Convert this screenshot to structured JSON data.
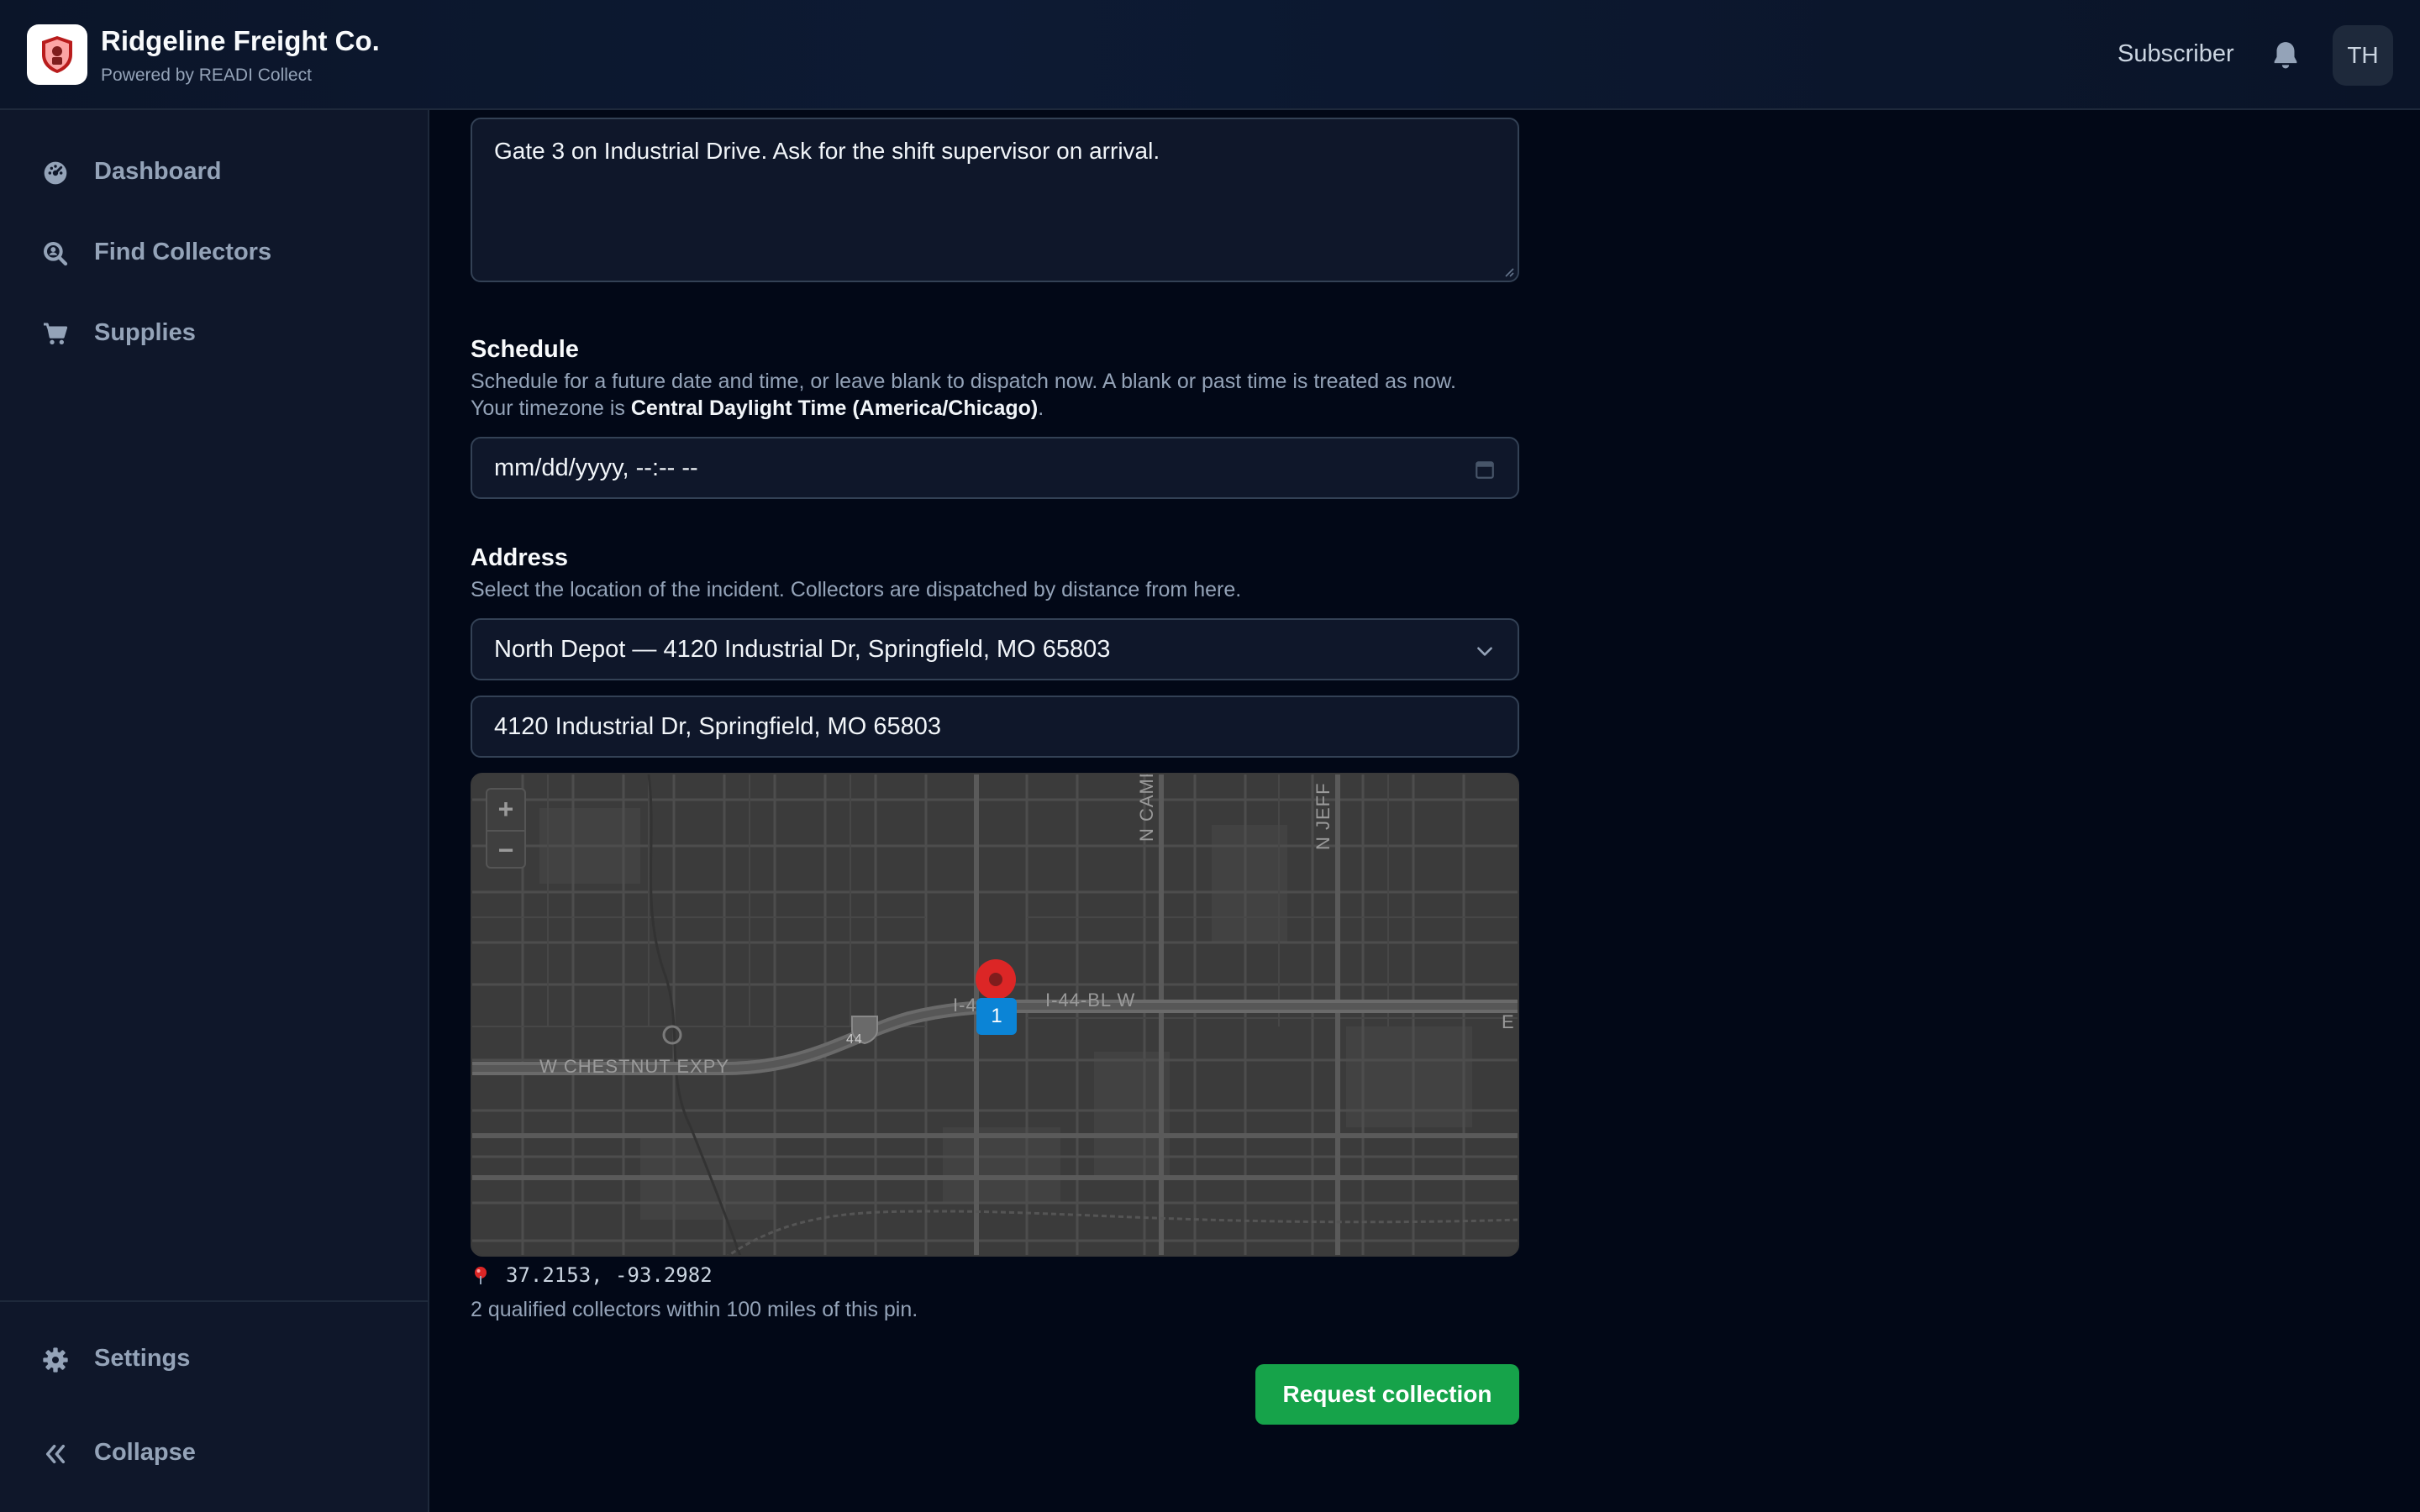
{
  "header": {
    "brand_name": "Ridgeline Freight Co.",
    "brand_sub": "Powered by READI Collect",
    "role_label": "Subscriber",
    "avatar_initials": "TH",
    "icons": [
      "shield-logo-icon",
      "bell-icon"
    ]
  },
  "sidebar": {
    "items": [
      {
        "label": "Dashboard",
        "icon": "dashboard-gauge-icon"
      },
      {
        "label": "Find Collectors",
        "icon": "search-person-icon"
      },
      {
        "label": "Supplies",
        "icon": "cart-icon"
      }
    ],
    "footer": [
      {
        "label": "Settings",
        "icon": "gear-icon"
      },
      {
        "label": "Collapse",
        "icon": "chevrons-left-icon"
      }
    ]
  },
  "form": {
    "notes_value": "Gate 3 on Industrial Drive. Ask for the shift supervisor on arrival.",
    "schedule": {
      "title": "Schedule",
      "desc_line1": "Schedule for a future date and time, or leave blank to dispatch now. A blank or past time is treated as now.",
      "desc_line2_prefix": "Your timezone is ",
      "timezone": "Central Daylight Time (America/Chicago)",
      "desc_line2_suffix": ".",
      "placeholder": "mm/dd/yyyy, --:-- --"
    },
    "address": {
      "title": "Address",
      "desc": "Select the location of the incident. Collectors are dispatched by distance from here.",
      "selected_location": "North Depot — 4120 Industrial Dr, Springfield, MO 65803",
      "address_value": "4120 Industrial Dr, Springfield, MO 65803"
    },
    "map": {
      "zoom_in": "+",
      "zoom_out": "−",
      "cluster_count": "1",
      "labels": {
        "campbell": "N CAMPBELL",
        "jefferson": "N JEFF",
        "i44_bl": "I-44-BL W",
        "i44_e": "I-4 E",
        "shield": "44",
        "chestnut": "W CHESTNUT EXPY",
        "edge_e": "E"
      }
    },
    "coords": "37.2153, -93.2982",
    "collectors_note": "2 qualified collectors within 100 miles of this pin.",
    "submit_label": "Request collection"
  },
  "colors": {
    "background": "#020817",
    "sidebar": "#0f172a",
    "accent_green": "#16a34a",
    "pin_red": "#dc2626",
    "cluster_blue": "#0b84d6"
  }
}
